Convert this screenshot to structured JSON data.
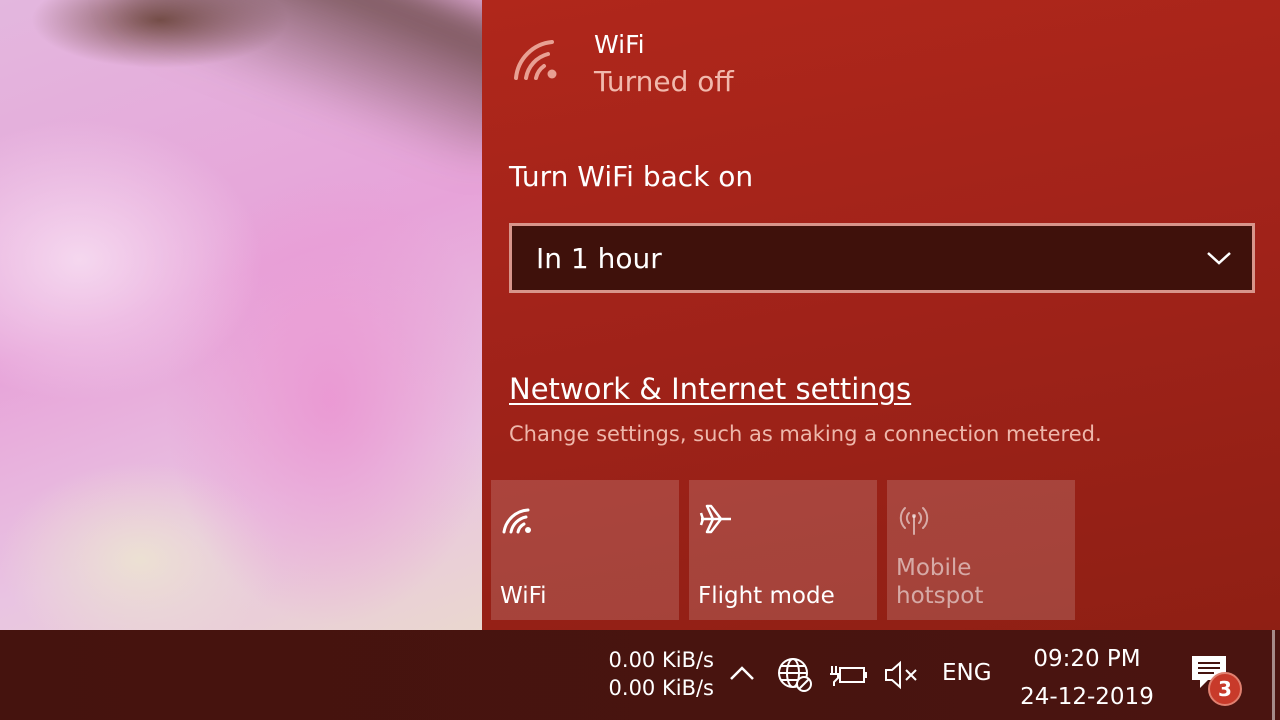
{
  "wifi": {
    "title": "WiFi",
    "status": "Turned off",
    "icon": "wifi-off-icon"
  },
  "turn_on": {
    "label": "Turn WiFi back on",
    "dropdown_value": "In 1 hour"
  },
  "settings": {
    "link": "Network & Internet settings",
    "description": "Change settings, such as making a connection metered."
  },
  "quick_actions": [
    {
      "label": "WiFi",
      "icon": "wifi-icon",
      "enabled": true
    },
    {
      "label": "Flight mode",
      "icon": "airplane-icon",
      "enabled": true
    },
    {
      "label": "Mobile hotspot",
      "icon": "hotspot-icon",
      "enabled": false
    }
  ],
  "taskbar": {
    "upload_speed": "0.00 KiB/s",
    "download_speed": "0.00 KiB/s",
    "language": "ENG",
    "time": "09:20 PM",
    "date": "24-12-2019",
    "notification_count": "3"
  },
  "colors": {
    "flyout_bg": "#a3231a",
    "dropdown_bg": "#3f110b",
    "taskbar_bg": "#45130e",
    "accent_text": "#f1b9ad"
  }
}
